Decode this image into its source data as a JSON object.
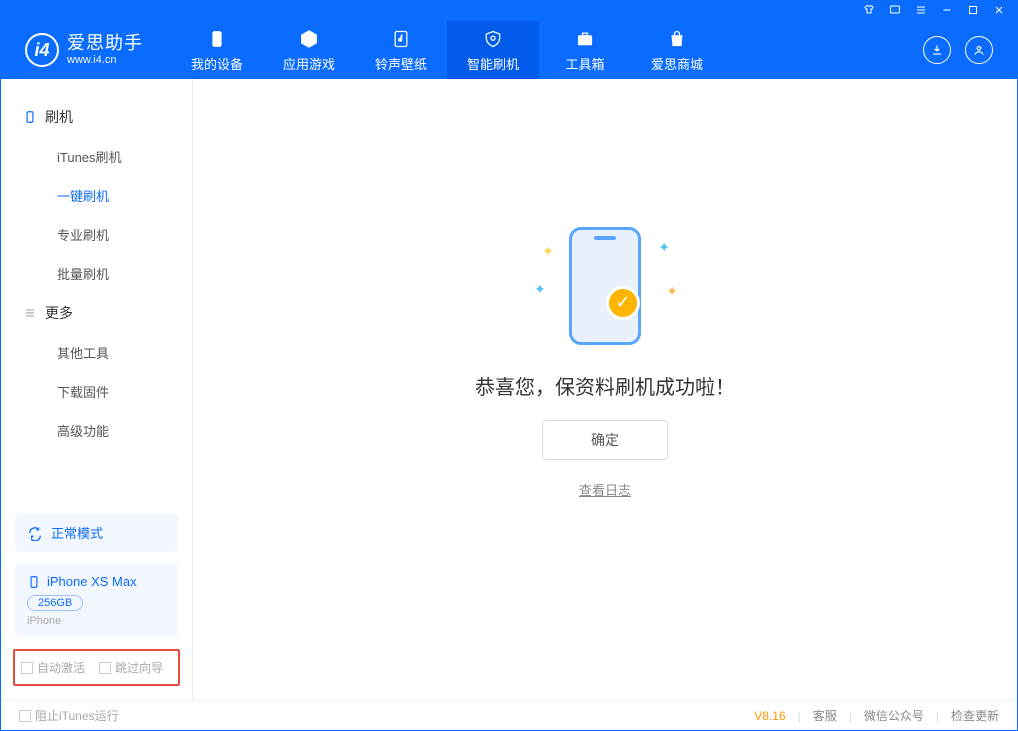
{
  "app": {
    "name_cn": "爱思助手",
    "url": "www.i4.cn"
  },
  "tabs": [
    {
      "label": "我的设备"
    },
    {
      "label": "应用游戏"
    },
    {
      "label": "铃声壁纸"
    },
    {
      "label": "智能刷机"
    },
    {
      "label": "工具箱"
    },
    {
      "label": "爱思商城"
    }
  ],
  "sidebar": {
    "group1_title": "刷机",
    "items": [
      {
        "label": "iTunes刷机"
      },
      {
        "label": "一键刷机",
        "active": true
      },
      {
        "label": "专业刷机"
      },
      {
        "label": "批量刷机"
      }
    ],
    "group2_title": "更多",
    "items2": [
      {
        "label": "其他工具"
      },
      {
        "label": "下载固件"
      },
      {
        "label": "高级功能"
      }
    ]
  },
  "mode": {
    "label": "正常模式"
  },
  "device": {
    "name": "iPhone XS Max",
    "storage": "256GB",
    "type": "iPhone"
  },
  "options": {
    "auto_activate": "自动激活",
    "skip_guide": "跳过向导"
  },
  "main": {
    "success": "恭喜您，保资料刷机成功啦！",
    "ok": "确定",
    "view_log": "查看日志"
  },
  "footer": {
    "block_itunes": "阻止iTunes运行",
    "version": "V8.16",
    "service": "客服",
    "wechat": "微信公众号",
    "update": "检查更新"
  }
}
